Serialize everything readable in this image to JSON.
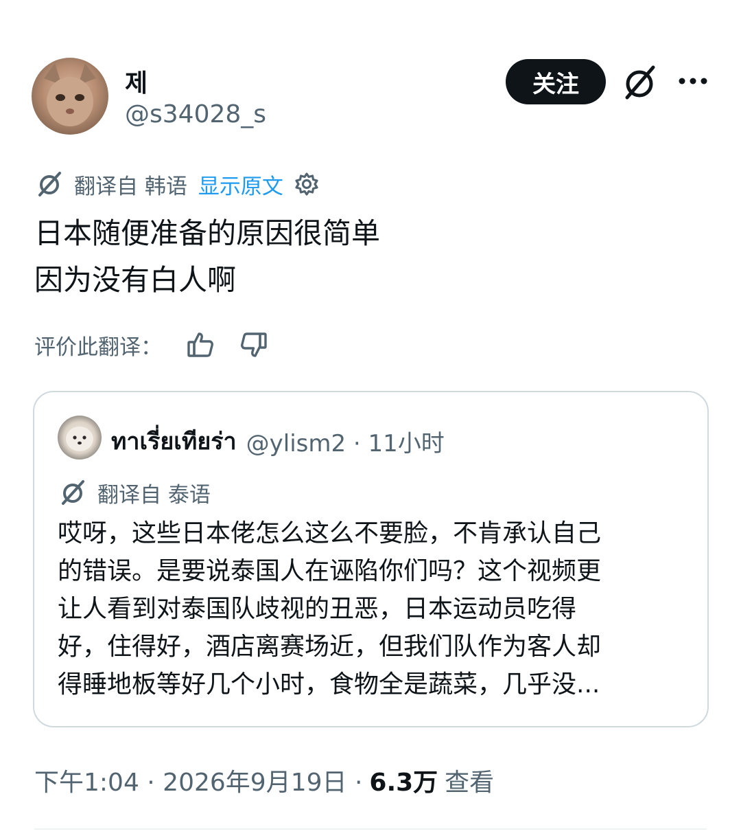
{
  "author": {
    "display_name": "제",
    "handle": "@s34028_s"
  },
  "actions": {
    "follow_label": "关注"
  },
  "translation": {
    "label": "翻译自 韩语",
    "show_original": "显示原文"
  },
  "tweet": {
    "lines": [
      "日本随便准备的原因很简单",
      "因为没有白人啊"
    ]
  },
  "rate": {
    "label": "评价此翻译："
  },
  "quote": {
    "name": "ทาเรี่ยเทียร่า",
    "meta": "@ylism2 · 11小时",
    "translation_label": "翻译自 泰语",
    "lines": [
      "哎呀，这些日本佬怎么这么不要脸，不肯承认自己",
      "的错误。是要说泰国人在诬陷你们吗？这个视频更",
      "让人看到对泰国队歧视的丑恶，日本运动员吃得",
      "好，住得好，酒店离赛场近，但我们队作为客人却",
      "得睡地板等好几个小时，食物全是蔬菜，几乎没..."
    ]
  },
  "footer": {
    "time_date": "下午1:04 · 2026年9月19日 ·",
    "views_count": "6.3万",
    "views_label": "查看"
  },
  "icons": {
    "grok": "grok-icon",
    "more": "more-icon",
    "translate": "translate-icon",
    "settings": "gear-icon",
    "thumbs_up": "thumbs-up-icon",
    "thumbs_down": "thumbs-down-icon"
  },
  "colors": {
    "link": "#1d9bf0",
    "secondary_text": "#536471",
    "primary_text": "#0f1419",
    "follow_button_bg": "#0f1419"
  }
}
